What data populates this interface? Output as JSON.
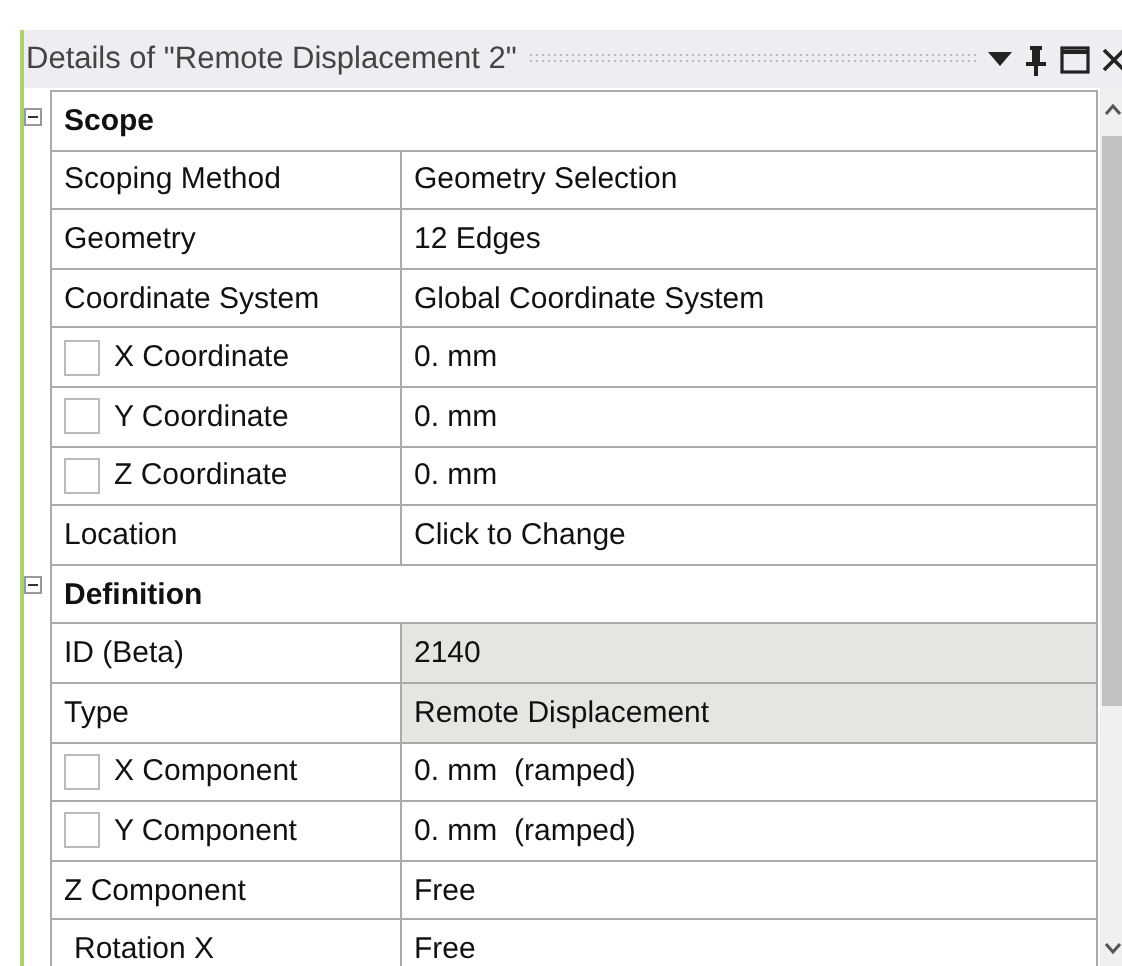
{
  "window": {
    "title": "Details of \"Remote Displacement 2\""
  },
  "sections": [
    {
      "title": "Scope",
      "expanded": true,
      "rows": [
        {
          "kind": "plain",
          "label": "Scoping Method",
          "value": "Geometry Selection",
          "shaded": false
        },
        {
          "kind": "plain",
          "label": "Geometry",
          "value": "12 Edges",
          "shaded": false
        },
        {
          "kind": "plain",
          "label": "Coordinate System",
          "value": "Global Coordinate System",
          "shaded": false
        },
        {
          "kind": "checkbox",
          "checked": false,
          "label": "X Coordinate",
          "value": "0. mm",
          "shaded": false
        },
        {
          "kind": "checkbox",
          "checked": false,
          "label": "Y Coordinate",
          "value": "0. mm",
          "shaded": false
        },
        {
          "kind": "checkbox",
          "checked": false,
          "label": "Z Coordinate",
          "value": "0. mm",
          "shaded": false
        },
        {
          "kind": "plain",
          "label": "Location",
          "value": "Click to Change",
          "shaded": false
        }
      ]
    },
    {
      "title": "Definition",
      "expanded": true,
      "rows": [
        {
          "kind": "plain",
          "label": "ID (Beta)",
          "value": "2140",
          "shaded": true
        },
        {
          "kind": "plain",
          "label": "Type",
          "value": "Remote Displacement",
          "shaded": true
        },
        {
          "kind": "checkbox",
          "checked": false,
          "label": "X Component",
          "value": "0. mm  (ramped)",
          "shaded": false
        },
        {
          "kind": "checkbox",
          "checked": false,
          "label": "Y Component",
          "value": "0. mm  (ramped)",
          "shaded": false
        },
        {
          "kind": "plain",
          "label": "Z Component",
          "value": "Free",
          "shaded": false
        },
        {
          "kind": "indented",
          "label": "Rotation X",
          "value": "Free",
          "shaded": false
        }
      ]
    }
  ]
}
